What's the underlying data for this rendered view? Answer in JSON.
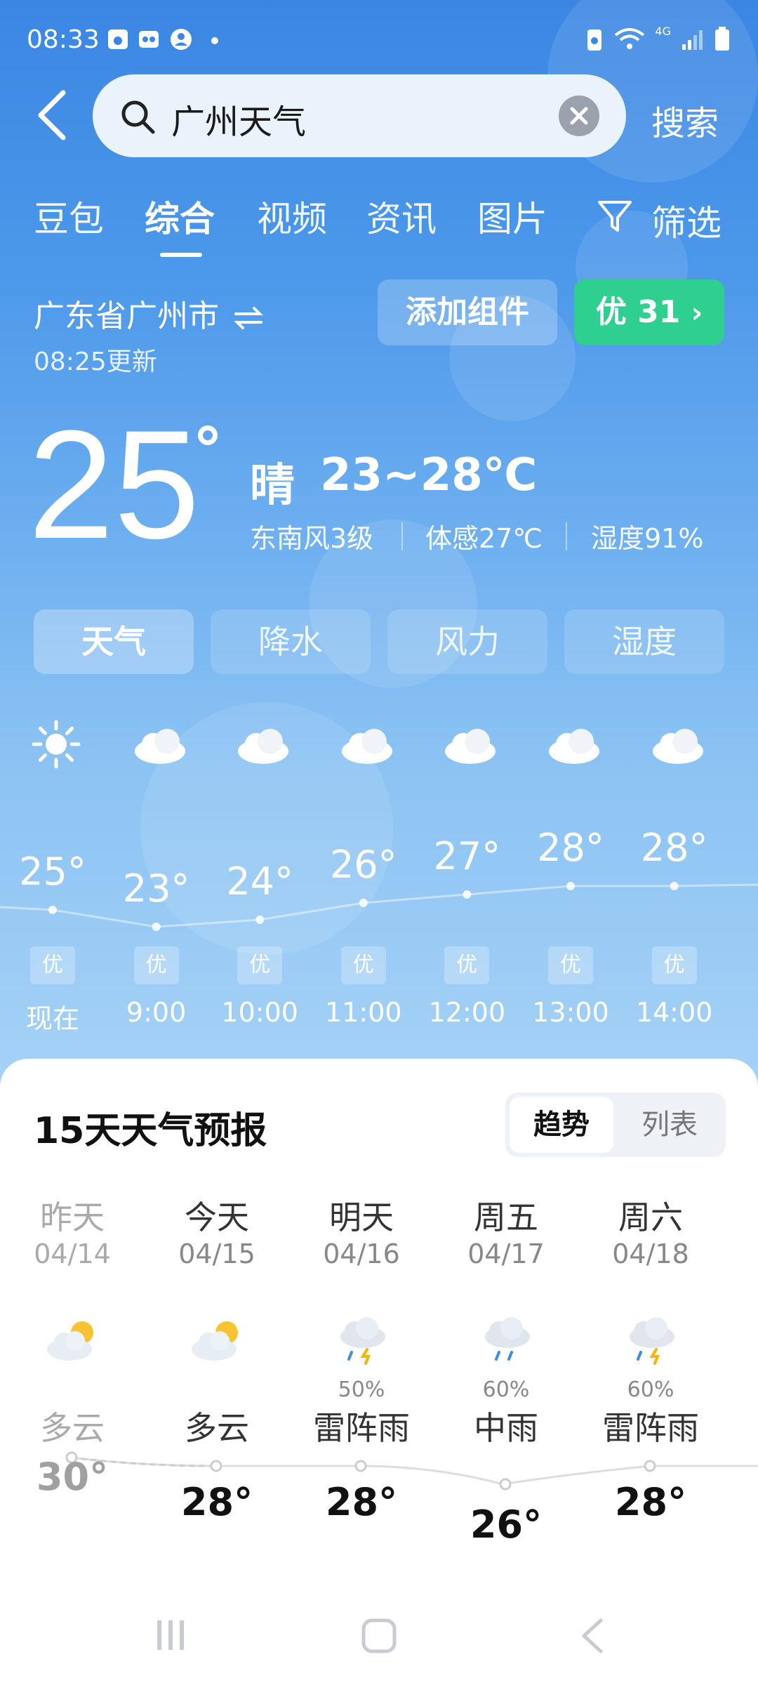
{
  "status": {
    "time": "08:33",
    "network": "4G"
  },
  "search": {
    "query": "广州天气",
    "button": "搜索"
  },
  "tabs": [
    "豆包",
    "综合",
    "视频",
    "资讯",
    "图片",
    "筛选"
  ],
  "location": {
    "name": "广东省广州市",
    "updated": "08:25更新",
    "add_widget": "添加组件",
    "aqi": "优 31"
  },
  "current": {
    "temp": "25",
    "condition": "晴",
    "range": "23~28℃",
    "wind": "东南风3级",
    "feels": "体感27℃",
    "humidity": "湿度91%"
  },
  "segments": [
    "天气",
    "降水",
    "风力",
    "湿度"
  ],
  "hourly": [
    {
      "label": "现在",
      "temp": "25°",
      "aqi": "优",
      "icon": "sun-icon"
    },
    {
      "label": "9:00",
      "temp": "23°",
      "aqi": "优",
      "icon": "cloud-icon"
    },
    {
      "label": "10:00",
      "temp": "24°",
      "aqi": "优",
      "icon": "cloud-icon"
    },
    {
      "label": "11:00",
      "temp": "26°",
      "aqi": "优",
      "icon": "cloud-icon"
    },
    {
      "label": "12:00",
      "temp": "27°",
      "aqi": "优",
      "icon": "cloud-icon"
    },
    {
      "label": "13:00",
      "temp": "28°",
      "aqi": "优",
      "icon": "cloud-icon"
    },
    {
      "label": "14:00",
      "temp": "28°",
      "aqi": "优",
      "icon": "cloud-icon"
    }
  ],
  "forecast": {
    "title": "15天天气预报",
    "toggle": [
      "趋势",
      "列表"
    ],
    "days": [
      {
        "name": "昨天",
        "date": "04/14",
        "cond": "多云",
        "high": "30°",
        "prob": "",
        "icon": "partly-cloudy-icon"
      },
      {
        "name": "今天",
        "date": "04/15",
        "cond": "多云",
        "high": "28°",
        "prob": "",
        "icon": "partly-cloudy-icon"
      },
      {
        "name": "明天",
        "date": "04/16",
        "cond": "雷阵雨",
        "high": "28°",
        "prob": "50%",
        "icon": "thunderstorm-icon"
      },
      {
        "name": "周五",
        "date": "04/17",
        "cond": "中雨",
        "high": "26°",
        "prob": "60%",
        "icon": "rain-icon"
      },
      {
        "name": "周六",
        "date": "04/18",
        "cond": "雷阵雨",
        "high": "28°",
        "prob": "60%",
        "icon": "thunderstorm-icon"
      }
    ]
  }
}
